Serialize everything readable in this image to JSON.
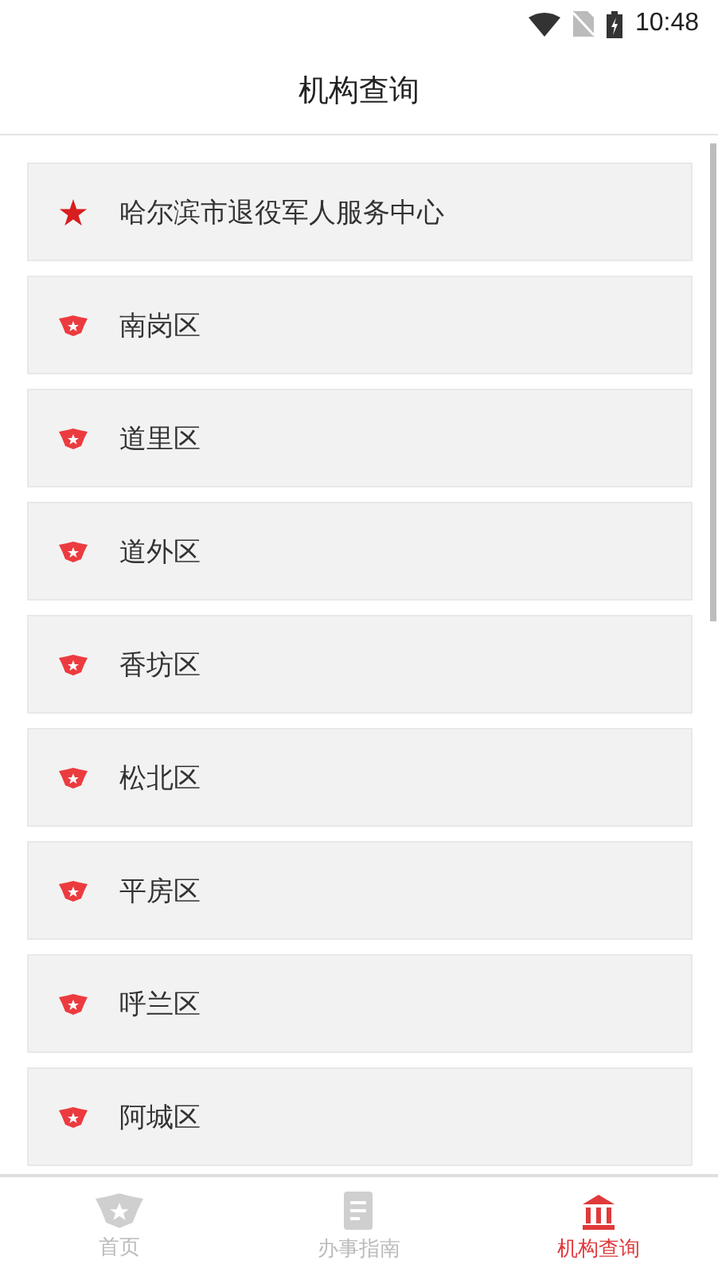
{
  "status_bar": {
    "time": "10:48"
  },
  "header": {
    "title": "机构查询"
  },
  "organizations": [
    {
      "name": "哈尔滨市退役军人服务中心",
      "kind": "star"
    },
    {
      "name": "南岗区",
      "kind": "emblem"
    },
    {
      "name": "道里区",
      "kind": "emblem"
    },
    {
      "name": "道外区",
      "kind": "emblem"
    },
    {
      "name": "香坊区",
      "kind": "emblem"
    },
    {
      "name": "松北区",
      "kind": "emblem"
    },
    {
      "name": "平房区",
      "kind": "emblem"
    },
    {
      "name": "呼兰区",
      "kind": "emblem"
    },
    {
      "name": "阿城区",
      "kind": "emblem"
    }
  ],
  "bottom_nav": [
    {
      "label": "首页",
      "selected": false
    },
    {
      "label": "办事指南",
      "selected": false
    },
    {
      "label": "机构查询",
      "selected": true
    }
  ]
}
